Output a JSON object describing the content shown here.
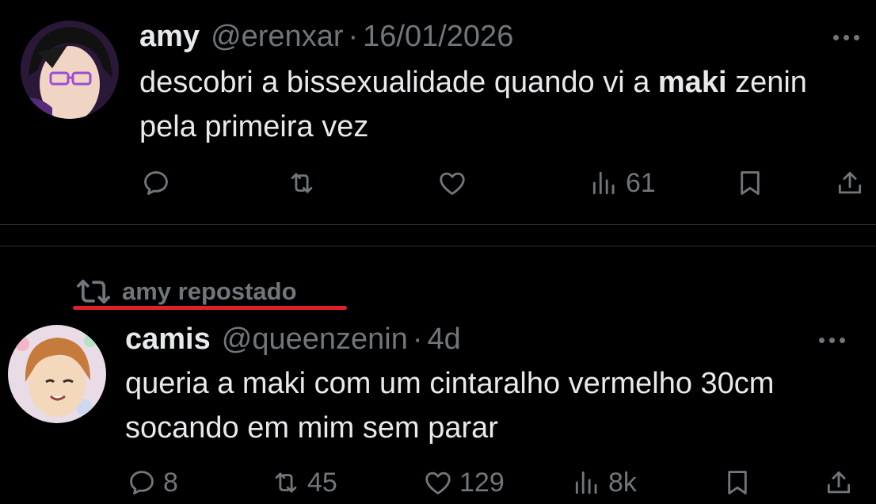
{
  "tweets": [
    {
      "author_name": "amy",
      "handle": "@erenxar",
      "separator": "·",
      "timestamp": "16/01/2026",
      "text_before": "descobri a bissexualidade quando vi a ",
      "text_bold": "maki",
      "text_after": " zenin pela primeira vez",
      "replies": "",
      "reposts": "",
      "likes": "",
      "views": "61"
    },
    {
      "repost_context": "amy repostado",
      "author_name": "camis",
      "handle": "@queenzenin",
      "separator": "·",
      "timestamp": "4d",
      "text": "queria a maki com um cintaralho vermelho 30cm socando em mim sem parar",
      "replies": "8",
      "reposts": "45",
      "likes": "129",
      "views": "8k"
    }
  ],
  "colors": {
    "background": "#000000",
    "text": "#e7e9ea",
    "muted": "#71767b",
    "divider": "#2f3336",
    "highlight_underline": "#e0202a"
  },
  "icons": [
    "reply-icon",
    "repost-icon",
    "like-icon",
    "views-icon",
    "bookmark-icon",
    "share-icon",
    "more-icon"
  ]
}
